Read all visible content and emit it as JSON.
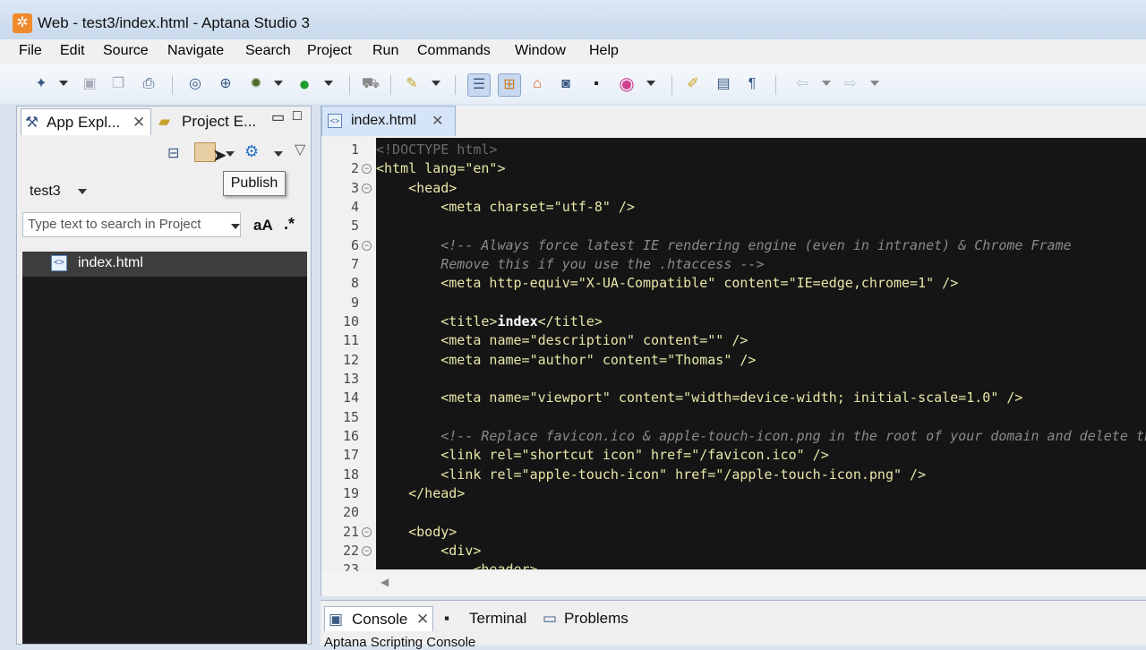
{
  "window": {
    "title": "Web - test3/index.html - Aptana Studio 3"
  },
  "menu": [
    "File",
    "Edit",
    "Source",
    "Navigate",
    "Search",
    "Project",
    "Run",
    "Commands",
    "Window",
    "Help"
  ],
  "left_panel": {
    "tab_app_explorer": "App Expl...",
    "tab_project_explorer": "Project E...",
    "project_selector": "test3",
    "search_placeholder": "Type text to search in Project",
    "case_toggle": "aA",
    "regex_toggle": ".*",
    "tree_item": "index.html",
    "tooltip": "Publish"
  },
  "editor": {
    "tab_label": "index.html",
    "line_numbers": [
      "1",
      "2",
      "3",
      "4",
      "5",
      "6",
      "7",
      "8",
      "9",
      "10",
      "11",
      "12",
      "13",
      "14",
      "15",
      "16",
      "17",
      "18",
      "19",
      "20",
      "21",
      "22",
      "23"
    ]
  },
  "bottom_panel": {
    "console_tab": "Console",
    "terminal_tab": "Terminal",
    "problems_tab": "Problems",
    "console_text": "Aptana Scripting Console"
  },
  "colors": {
    "editor_bg": "#151515",
    "tag": "#e7e6a8",
    "comment": "#8a8a8a"
  }
}
